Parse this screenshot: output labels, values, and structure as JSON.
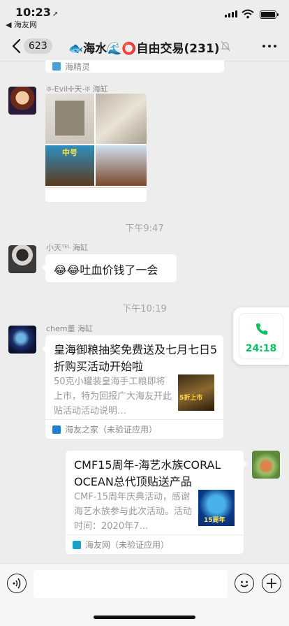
{
  "status_bar": {
    "time": "10:23",
    "back_app": "◀ 海友网"
  },
  "nav": {
    "unread_count": "623",
    "title_emoji": "🐟",
    "title_part1": "海水",
    "title_emoji2": "🌊⭕",
    "title_part2": "自由交易",
    "member_count": "(231)"
  },
  "messages": {
    "prev_source": "海精灵",
    "msg1": {
      "sender": "ক-Evil✢天-ক 海缸",
      "image_caption": "中号"
    },
    "ts1": "下午9:47",
    "msg2": {
      "sender": "小天ᵀᴱᴸ 海缸",
      "text": "吐血价钱了一会",
      "emoji": "😂😂"
    },
    "ts2": "下午10:19",
    "msg3": {
      "sender": "chem董 海缸",
      "title": "皇海御粮抽奖免费送及七月七日5折购买活动开始啦",
      "desc": "50克小罐装皇海手工粮即将上市，特为回报广大海友开此贴活动活动说明…",
      "thumb_text": "5折上市",
      "source": "海友之家（未验证应用）"
    },
    "msg4": {
      "title": "CMF15周年-海艺水族CORAL OCEAN总代顶贴送产品",
      "desc": "CMF-15周年庆典活动，感谢海艺水族参与此次活动。活动时间：2020年7…",
      "thumb_text": "15周年",
      "source": "海友网（未验证应用）"
    }
  },
  "call_float": {
    "duration": "24:18"
  },
  "colors": {
    "accent_green": "#07c160",
    "chat_bg": "#ededed"
  }
}
